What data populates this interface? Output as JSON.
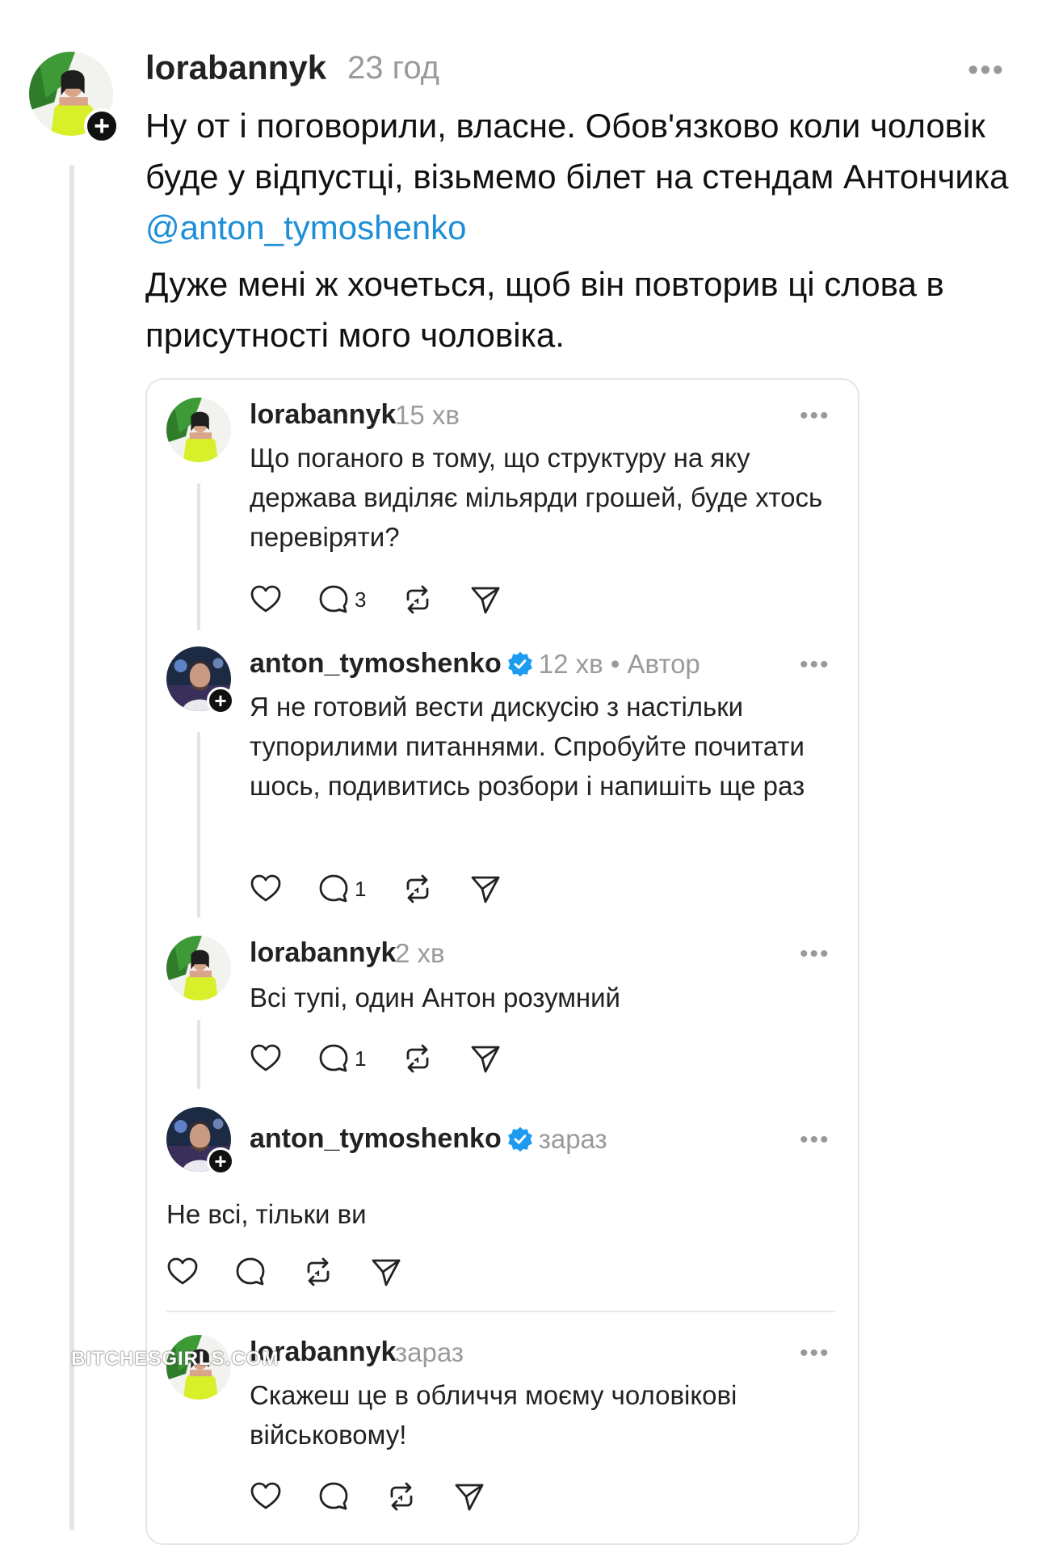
{
  "main_post": {
    "username": "lorabannyk",
    "time": "23 год",
    "more": "•••",
    "text_line1": "Ну от і поговорили, власне. Обов'язково  коли чоловік буде у відпустці, візьмемо білет на стендам  Антончика ",
    "mention": "@anton_tymoshenko",
    "text_line2": "Дуже мені ж хочеться, щоб він повторив ці слова в присутності мого чоловіка."
  },
  "quote_thread": [
    {
      "username": "lorabannyk",
      "time": "15 хв",
      "text": "Що поганого в тому, що структуру на яку держава виділяє мільярди грошей, буде хтось перевіряти?",
      "replies_count": "3",
      "more": "•••"
    },
    {
      "username": "anton_tymoshenko",
      "time": "12 хв • Автор",
      "verified": true,
      "text": "Я не готовий вести дискусію з настільки тупорилими питаннями. Спробуйте почитати шось, подивитись розбори і напишіть ще раз",
      "replies_count": "1",
      "more": "•••"
    },
    {
      "username": "lorabannyk",
      "time": "2 хв",
      "text": "Всі тупі, один Антон розумний",
      "replies_count": "1",
      "more": "•••"
    },
    {
      "username": "anton_tymoshenko",
      "time": "зараз",
      "verified": true,
      "text": "Не всі, тільки ви",
      "more": "•••"
    },
    {
      "username": "lorabannyk",
      "time": "зараз",
      "text": "Скажеш це в обличчя моєму чоловікові військовому!",
      "more": "•••"
    }
  ],
  "watermark": "BITCHESGIRLS.COM",
  "colors": {
    "mention": "#1d8fd8",
    "verified": "#1d9bf0",
    "muted": "#9a9a9a",
    "line": "#e4e4e4"
  },
  "icons": [
    "heart-icon",
    "comment-icon",
    "repost-icon",
    "share-icon",
    "verified-icon",
    "plus-icon",
    "more-icon"
  ]
}
